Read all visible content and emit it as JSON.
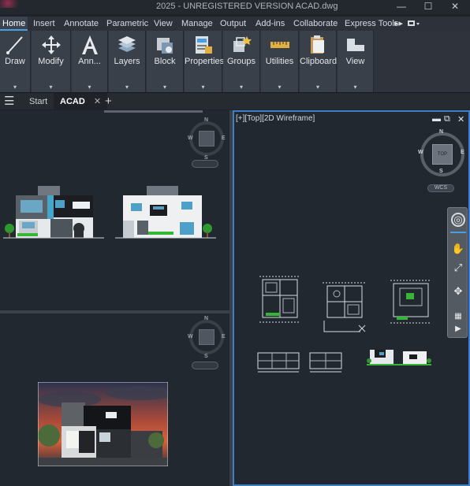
{
  "window": {
    "title": "2025 - UNREGISTERED VERSION    ACAD.dwg",
    "minimize": "—",
    "maximize": "☐",
    "close": "✕"
  },
  "ribbon_tabs": [
    "Home",
    "Insert",
    "Annotate",
    "Parametric",
    "View",
    "Manage",
    "Output",
    "Add-ins",
    "Collaborate",
    "Express Tools",
    "▸▸"
  ],
  "ribbon_panels": [
    {
      "label": "Draw",
      "icon": "draw-line-icon"
    },
    {
      "label": "Modify",
      "icon": "move-arrows-icon"
    },
    {
      "label": "Ann...",
      "icon": "text-a-icon"
    },
    {
      "label": "Layers",
      "icon": "layers-icon"
    },
    {
      "label": "Block",
      "icon": "block-insert-icon"
    },
    {
      "label": "Properties",
      "icon": "properties-icon"
    },
    {
      "label": "Groups",
      "icon": "groups-icon"
    },
    {
      "label": "Utilities",
      "icon": "ruler-icon"
    },
    {
      "label": "Clipboard",
      "icon": "clipboard-icon"
    },
    {
      "label": "View",
      "icon": "view-icon"
    }
  ],
  "panel_dropdown": "▾",
  "doc_tabs": {
    "menu_icon": "☰",
    "start": "Start",
    "active": "ACAD",
    "close": "✕",
    "new": "+"
  },
  "viewports": {
    "right_label": "[+][Top][2D Wireframe]",
    "controls": [
      "▬",
      "⧉",
      "✕"
    ]
  },
  "viewcube": {
    "north": "N",
    "south": "S",
    "east": "E",
    "west": "W",
    "top_face": "TOP",
    "wcs": "WCS"
  },
  "colors": {
    "accent": "#4a9fe0",
    "viewport_active_border": "#3d7fc9",
    "background": "#212830"
  }
}
